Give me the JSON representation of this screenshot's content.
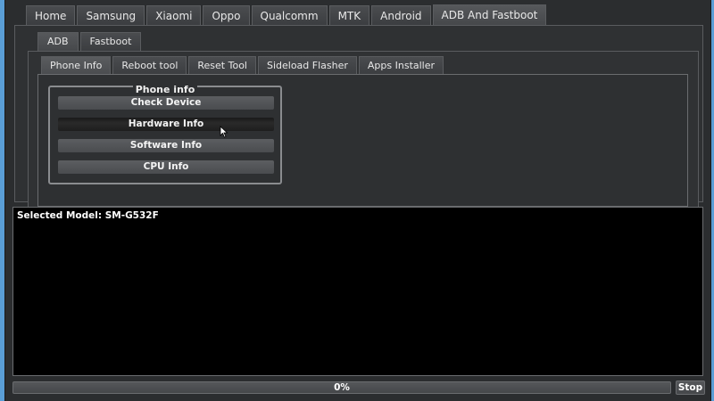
{
  "main_tabs": [
    {
      "label": "Home"
    },
    {
      "label": "Samsung"
    },
    {
      "label": "Xiaomi"
    },
    {
      "label": "Oppo"
    },
    {
      "label": "Qualcomm"
    },
    {
      "label": "MTK"
    },
    {
      "label": "Android"
    },
    {
      "label": "ADB And Fastboot",
      "active": true
    }
  ],
  "sub_tabs": [
    {
      "label": "ADB",
      "active": true
    },
    {
      "label": "Fastboot"
    }
  ],
  "inner_tabs": [
    {
      "label": "Phone Info",
      "active": true
    },
    {
      "label": "Reboot tool"
    },
    {
      "label": "Reset Tool"
    },
    {
      "label": "Sideload Flasher"
    },
    {
      "label": "Apps Installer"
    }
  ],
  "phone_info": {
    "group_title": "Phone info",
    "buttons": [
      {
        "label": "Check Device"
      },
      {
        "label": "Hardware Info",
        "hover": true
      },
      {
        "label": "Software Info"
      },
      {
        "label": "CPU Info"
      }
    ]
  },
  "console": {
    "lines": [
      "Selected Model: SM-G532F"
    ]
  },
  "progress": {
    "value": 0,
    "label": "0%"
  },
  "stop_label": "Stop",
  "colors": {
    "desktop": "#5a9ed6",
    "window_bg": "#2b2d2f",
    "console_bg": "#000000",
    "text": "#f0f0f0"
  }
}
